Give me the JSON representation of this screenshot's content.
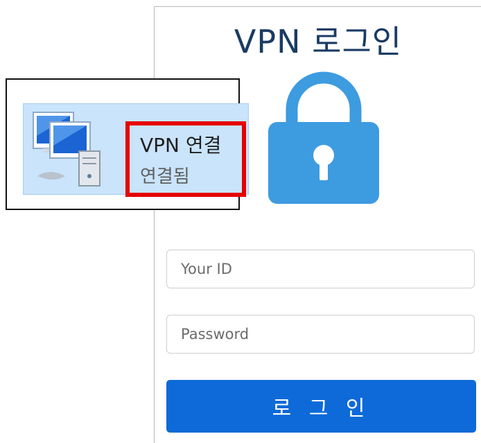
{
  "login": {
    "title": "VPN 로그인",
    "id_placeholder": "Your ID",
    "password_placeholder": "Password",
    "button_label": "로 그 인"
  },
  "vpn_connection": {
    "name": "VPN 연결",
    "status": "연결됨"
  },
  "colors": {
    "title": "#1a3b63",
    "lock": "#3d9be0",
    "button": "#0d6ad8",
    "highlight": "#e60000",
    "selection": "#c9e4fb"
  },
  "icons": {
    "lock": "lock-icon",
    "network": "network-connection-icon"
  }
}
